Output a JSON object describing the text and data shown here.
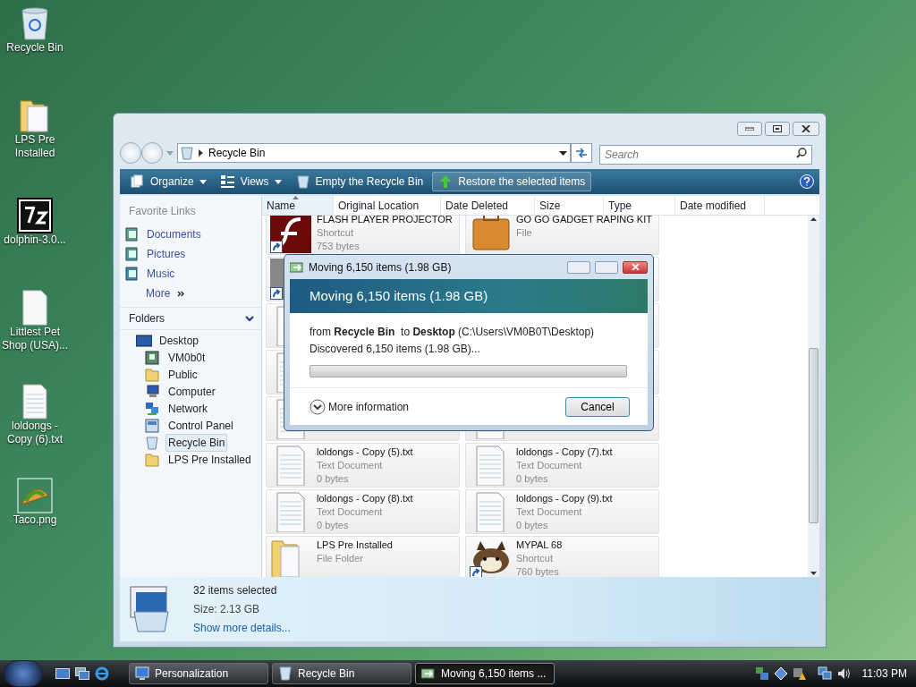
{
  "desktop_icons": [
    {
      "label": "Recycle Bin",
      "kind": "recycle"
    },
    {
      "label": "LPS Pre Installed",
      "kind": "folder"
    },
    {
      "label": "dolphin-3.0...",
      "kind": "archive"
    },
    {
      "label": "Littlest Pet Shop (USA)...",
      "kind": "blank"
    },
    {
      "label": "loldongs - Copy (6).txt",
      "kind": "text"
    },
    {
      "label": "Taco.png",
      "kind": "image"
    }
  ],
  "window": {
    "address": "Recycle Bin",
    "search": {
      "placeholder": "Search"
    }
  },
  "toolbar": [
    {
      "label": "Organize",
      "kind": "organize"
    },
    {
      "label": "Views",
      "kind": "views"
    },
    {
      "label": "Empty the Recycle Bin",
      "kind": "empty"
    },
    {
      "label": "Restore the selected items",
      "kind": "restore"
    }
  ],
  "favorite_links": {
    "title": "Favorite Links",
    "items": [
      {
        "label": "Documents",
        "kind": "documents"
      },
      {
        "label": "Pictures",
        "kind": "pictures"
      },
      {
        "label": "Music",
        "kind": "music"
      }
    ],
    "more": "More"
  },
  "folders": {
    "title": "Folders",
    "tree": [
      {
        "label": "Desktop",
        "kind": "desktop",
        "selected": false,
        "children": [
          {
            "label": "VM0b0t",
            "kind": "user",
            "selected": false
          },
          {
            "label": "Public",
            "kind": "folder",
            "selected": false
          },
          {
            "label": "Computer",
            "kind": "computer",
            "selected": false
          },
          {
            "label": "Network",
            "kind": "network",
            "selected": false
          },
          {
            "label": "Control Panel",
            "kind": "control",
            "selected": false
          },
          {
            "label": "Recycle Bin",
            "kind": "recycle",
            "selected": true
          },
          {
            "label": "LPS Pre Installed",
            "kind": "folder",
            "selected": false
          }
        ]
      }
    ]
  },
  "columns": [
    {
      "label": "Name",
      "sorted": true
    },
    {
      "label": "Original Location",
      "sorted": false
    },
    {
      "label": "Date Deleted",
      "sorted": false
    },
    {
      "label": "Size",
      "sorted": false
    },
    {
      "label": "Type",
      "sorted": false
    },
    {
      "label": "Date modified",
      "sorted": false
    }
  ],
  "files": [
    {
      "name": "FLASH PLAYER PROJECTOR",
      "type": "Shortcut",
      "size": "753 bytes",
      "kind": "flash",
      "shortcut": true
    },
    {
      "name": "GO GO GADGET RAPING KIT",
      "type": "File",
      "kind": "briefcase",
      "shortcut": false
    },
    {
      "kind": "photo",
      "shortcut": true
    },
    {
      "kind": "text"
    },
    {
      "kind": "blank"
    },
    {
      "kind": "text"
    },
    {
      "kind": "text"
    },
    {
      "kind": "text"
    },
    {
      "kind": "text"
    },
    {
      "kind": "text"
    },
    {
      "name": "loldongs - Copy (5).txt",
      "type": "Text Document",
      "size": "0 bytes",
      "kind": "text",
      "shortcut": false
    },
    {
      "name": "loldongs - Copy (7).txt",
      "type": "Text Document",
      "size": "0 bytes",
      "kind": "text",
      "shortcut": false
    },
    {
      "name": "loldongs - Copy (8).txt",
      "type": "Text Document",
      "size": "0 bytes",
      "kind": "text",
      "shortcut": false
    },
    {
      "name": "loldongs - Copy (9).txt",
      "type": "Text Document",
      "size": "0 bytes",
      "kind": "text",
      "shortcut": false
    },
    {
      "name": "LPS Pre Installed",
      "type": "File Folder",
      "kind": "folder",
      "shortcut": false
    },
    {
      "name": "MYPAL 68",
      "type": "Shortcut",
      "size": "760 bytes",
      "kind": "raccoon",
      "shortcut": true
    }
  ],
  "details": {
    "count": "32 items selected",
    "size": "Size: 2.13 GB",
    "link": "Show more details..."
  },
  "dialog": {
    "title": "Moving 6,150 items (1.98 GB)",
    "heading": "Moving 6,150 items (1.98 GB)",
    "from_line": "from **Recycle Bin**  to **Desktop** (C:\\Users\\VM0B0T\\Desktop)",
    "status": "Discovered 6,150 items (1.98 GB)...",
    "more": "More information",
    "cancel": "Cancel"
  },
  "taskbar": {
    "items": [
      {
        "label": "Personalization",
        "kind": "personalization",
        "selected": false
      },
      {
        "label": "Recycle Bin",
        "kind": "recycle",
        "selected": false
      },
      {
        "label": "Moving 6,150 items ...",
        "kind": "moving",
        "selected": true
      }
    ],
    "clock": "11:03 PM"
  }
}
